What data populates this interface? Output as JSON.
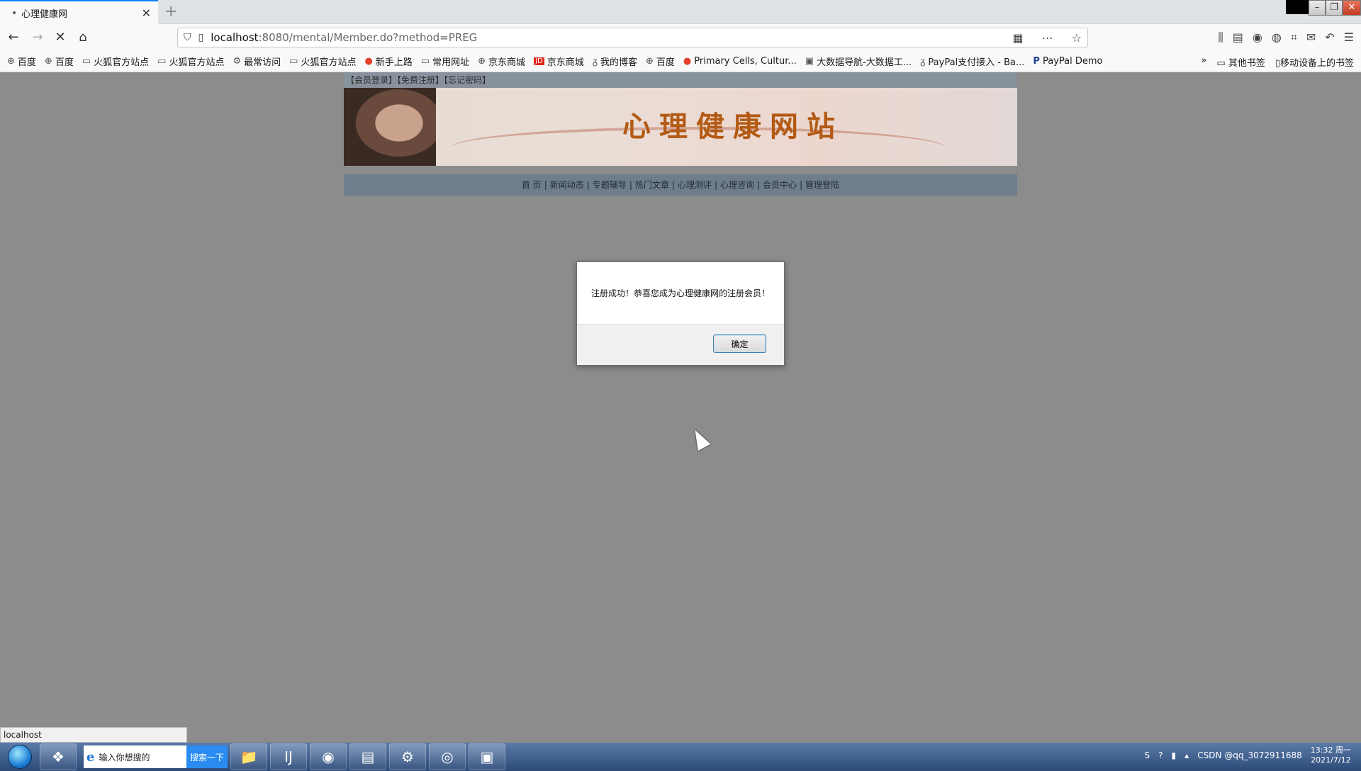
{
  "browser": {
    "tab_title": "心理健康网",
    "url_host": "localhost",
    "url_rest": ":8080/mental/Member.do?method=PREG",
    "status_text": "localhost"
  },
  "bookmarks": [
    {
      "label": "百度",
      "icon": "globe-icon"
    },
    {
      "label": "百度",
      "icon": "globe-icon"
    },
    {
      "label": "火狐官方站点",
      "icon": "folder-icon"
    },
    {
      "label": "火狐官方站点",
      "icon": "folder-icon"
    },
    {
      "label": "最常访问",
      "icon": "gear-icon"
    },
    {
      "label": "火狐官方站点",
      "icon": "folder-icon"
    },
    {
      "label": "新手上路",
      "icon": "firefox-icon"
    },
    {
      "label": "常用网址",
      "icon": "folder-icon"
    },
    {
      "label": "京东商城",
      "icon": "globe-icon"
    },
    {
      "label": "京东商城",
      "icon": "jd-icon"
    },
    {
      "label": "我的博客",
      "icon": "blog-icon"
    },
    {
      "label": "百度",
      "icon": "globe-icon"
    },
    {
      "label": "Primary Cells, Cultur...",
      "icon": "red-dot-icon"
    },
    {
      "label": "大数据导航-大数据工...",
      "icon": "image-icon"
    },
    {
      "label": "PayPal支付接入 - Ba...",
      "icon": "blog-icon"
    },
    {
      "label": "PayPal Demo",
      "icon": "paypal-icon"
    }
  ],
  "bookmarks_right": {
    "other": "其他书签",
    "mobile": "移动设备上的书签"
  },
  "site": {
    "top_links": "【会员登录】【免费注册】【忘记密码】",
    "name": "心理健康网站",
    "nav": [
      "首 页",
      "新闻动态",
      "专题辅导",
      "热门文章",
      "心理测评",
      "心理咨询",
      "会员中心",
      "管理登陆"
    ]
  },
  "alert": {
    "message": "注册成功！恭喜您成为心理健康网的注册会员！",
    "ok_label": "确定"
  },
  "taskbar": {
    "search_placeholder": "输入你想搜的",
    "search_button": "搜索一下",
    "clock_time": "13:32 周一",
    "clock_date": "2021/7/12",
    "tray_text": "CSDN @qq_3072911688"
  }
}
